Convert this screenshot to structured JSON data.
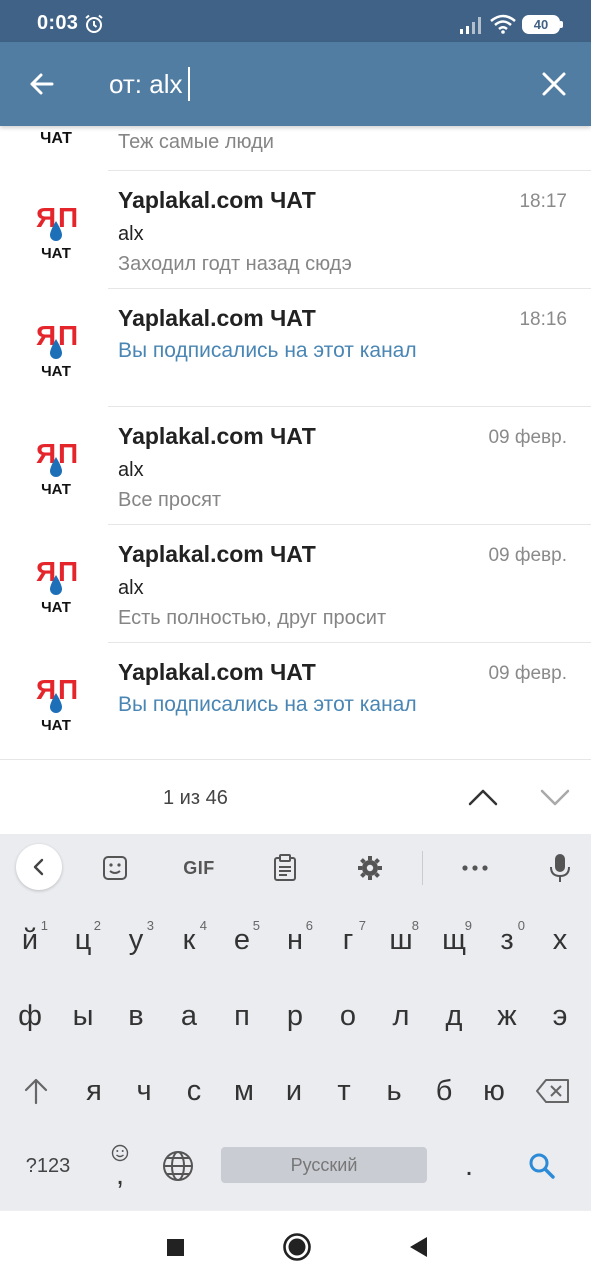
{
  "status_bar": {
    "time": "0:03",
    "battery": "40",
    "icons": [
      "alarm-icon",
      "signal-icon",
      "wifi-icon",
      "battery-icon"
    ]
  },
  "search": {
    "value": "от: alx",
    "back_icon": "arrow-left-icon",
    "clear_icon": "close-icon"
  },
  "results": {
    "partial_row": {
      "text": "Теж самые люди"
    },
    "rows": [
      {
        "title": "Yaplakal.com ЧАТ",
        "time": "18:17",
        "sender": "alx",
        "text": "Заходил годт назад сюдэ",
        "service": false
      },
      {
        "title": "Yaplakal.com ЧАТ",
        "time": "18:16",
        "sender": "",
        "text": "Вы подписались на этот канал",
        "service": true
      },
      {
        "title": "Yaplakal.com ЧАТ",
        "time": "09 февр.",
        "sender": "alx",
        "text": "Все просят",
        "service": false
      },
      {
        "title": "Yaplakal.com ЧАТ",
        "time": "09 февр.",
        "sender": "alx",
        "text": "Есть полностью, друг просит",
        "service": false
      },
      {
        "title": "Yaplakal.com ЧАТ",
        "time": "09 февр.",
        "sender": "",
        "text": "Вы подписались на этот канал",
        "service": true
      }
    ],
    "avatar": {
      "top_text": "ЯП",
      "bottom_text": "ЧАТ",
      "colors": {
        "red": "#e4262c",
        "drop": "#1d6fb8",
        "text": "#111111"
      }
    }
  },
  "pager": {
    "count": "1 из 46"
  },
  "keyboard": {
    "toolbar": [
      "chevron-left-icon",
      "sticker-icon",
      "GIF",
      "clipboard-icon",
      "gear-icon",
      "more-icon",
      "microphone-icon"
    ],
    "row1": [
      {
        "k": "й",
        "h": "1"
      },
      {
        "k": "ц",
        "h": "2"
      },
      {
        "k": "у",
        "h": "3"
      },
      {
        "k": "к",
        "h": "4"
      },
      {
        "k": "е",
        "h": "5"
      },
      {
        "k": "н",
        "h": "6"
      },
      {
        "k": "г",
        "h": "7"
      },
      {
        "k": "ш",
        "h": "8"
      },
      {
        "k": "щ",
        "h": "9"
      },
      {
        "k": "з",
        "h": "0"
      },
      {
        "k": "х",
        "h": ""
      }
    ],
    "row2": [
      "ф",
      "ы",
      "в",
      "а",
      "п",
      "р",
      "о",
      "л",
      "д",
      "ж",
      "э"
    ],
    "row3": [
      "я",
      "ч",
      "с",
      "м",
      "и",
      "т",
      "ь",
      "б",
      "ю"
    ],
    "sym_label": "?123",
    "comma": ",",
    "space_label": "Русский",
    "period": "."
  },
  "nav_bar": {
    "icons": [
      "recents-square-icon",
      "home-circle-icon",
      "back-triangle-icon"
    ]
  },
  "colors": {
    "status_bar": "#3f6286",
    "header": "#527da3",
    "link_blue": "#4a86b4",
    "search_key": "#2d8ad6"
  }
}
